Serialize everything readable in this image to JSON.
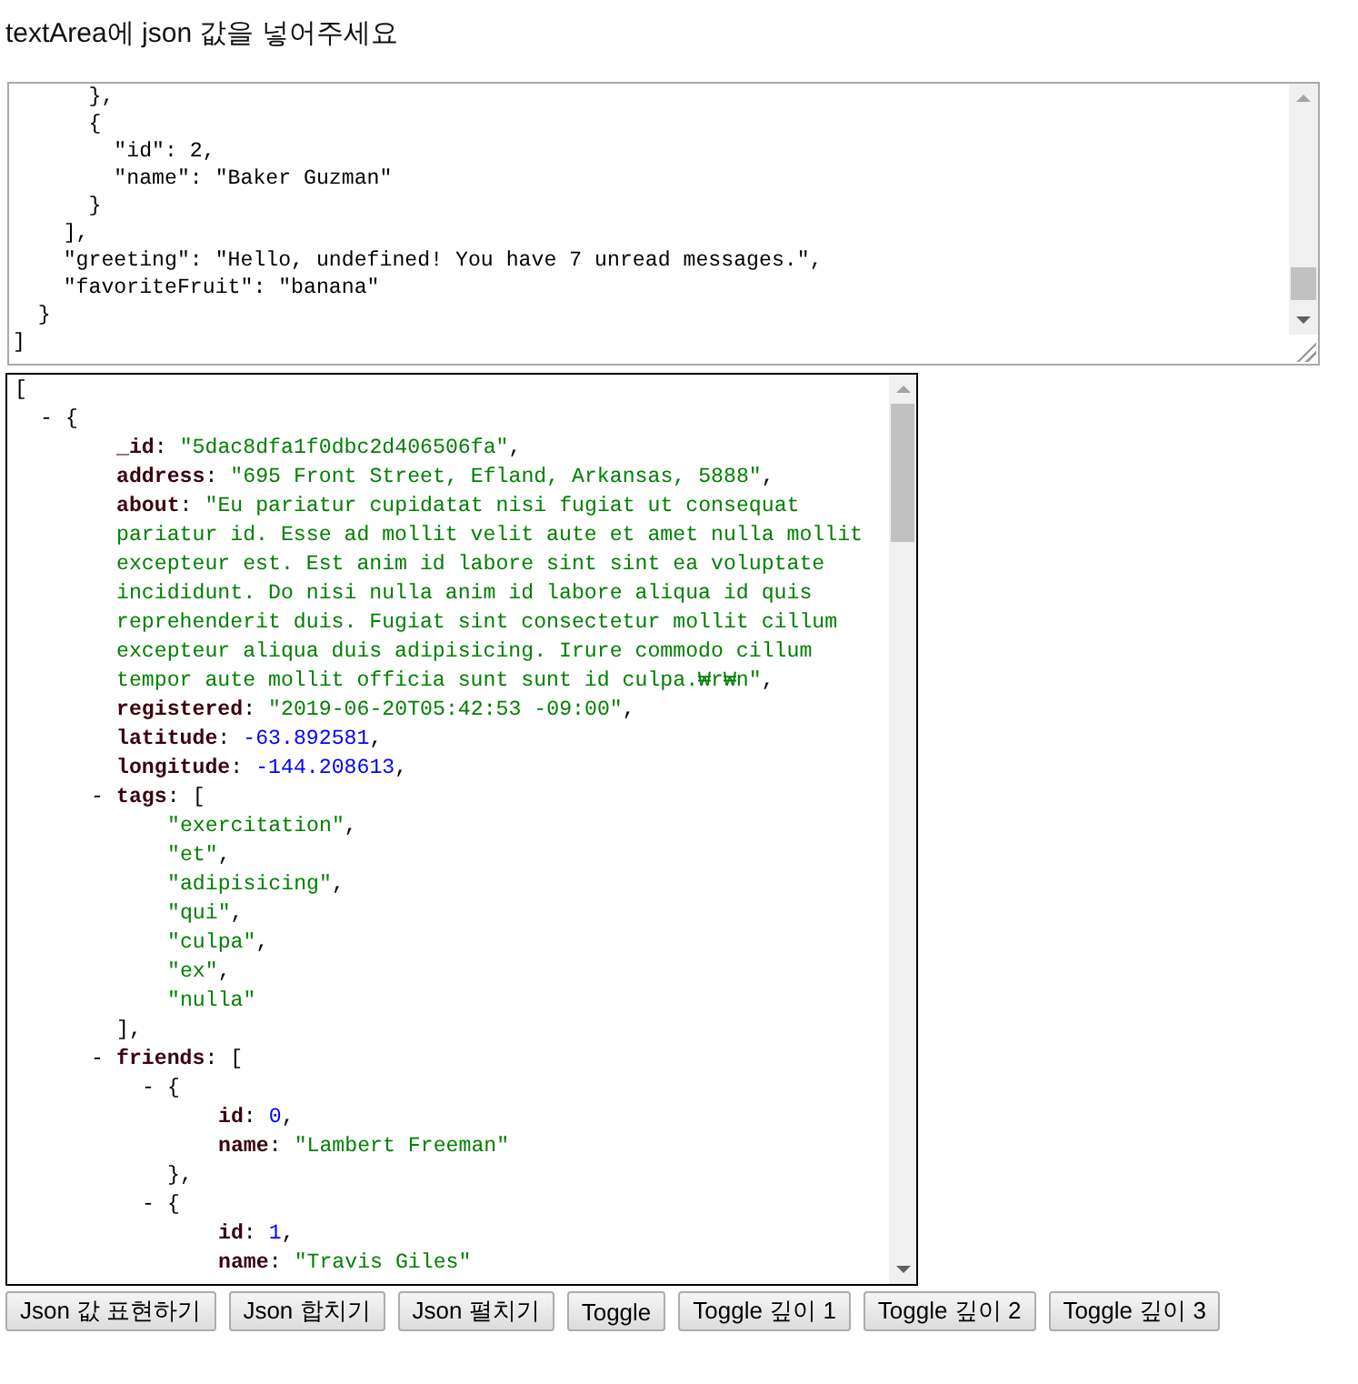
{
  "heading": "textArea에 json 값을 넣어주세요",
  "textarea": {
    "lines": [
      "      },",
      "      {",
      "        \"id\": 2,",
      "        \"name\": \"Baker Guzman\"",
      "      }",
      "    ],",
      "    \"greeting\": \"Hello, undefined! You have 7 unread messages.\",",
      "    \"favoriteFruit\": \"banana\"",
      "  }",
      "]"
    ]
  },
  "tree": {
    "open": "[",
    "children": [
      {
        "toggle": "-",
        "open": "{",
        "children": [
          {
            "key": "_id",
            "colon": ":",
            "value": "\"5dac8dfa1f0dbc2d406506fa\"",
            "kind": "string",
            "comma": ","
          },
          {
            "key": "address",
            "colon": ":",
            "value": "\"695 Front Street, Efland, Arkansas, 5888\"",
            "kind": "string",
            "comma": ","
          },
          {
            "key": "about",
            "colon": ":",
            "value": "\"Eu pariatur cupidatat nisi fugiat ut consequat pariatur id. Esse ad mollit velit aute et amet nulla mollit excepteur est. Est anim id labore sint sint ea voluptate incididunt. Do nisi nulla anim id labore aliqua id quis reprehenderit duis. Fugiat sint consectetur mollit cillum excepteur aliqua duis adipisicing. Irure commodo cillum tempor aute mollit officia sunt sunt id culpa.₩r₩n\"",
            "kind": "string",
            "comma": ","
          },
          {
            "key": "registered",
            "colon": ":",
            "value": "\"2019-06-20T05:42:53 -09:00\"",
            "kind": "string",
            "comma": ","
          },
          {
            "key": "latitude",
            "colon": ":",
            "value": "-63.892581",
            "kind": "number",
            "comma": ","
          },
          {
            "key": "longitude",
            "colon": ":",
            "value": "-144.208613",
            "kind": "number",
            "comma": ","
          },
          {
            "key": "tags",
            "colon": ":",
            "toggle": "-",
            "open": "[",
            "close": "]",
            "comma": ",",
            "children": [
              {
                "value": "\"exercitation\"",
                "kind": "string",
                "comma": ","
              },
              {
                "value": "\"et\"",
                "kind": "string",
                "comma": ","
              },
              {
                "value": "\"adipisicing\"",
                "kind": "string",
                "comma": ","
              },
              {
                "value": "\"qui\"",
                "kind": "string",
                "comma": ","
              },
              {
                "value": "\"culpa\"",
                "kind": "string",
                "comma": ","
              },
              {
                "value": "\"ex\"",
                "kind": "string",
                "comma": ","
              },
              {
                "value": "\"nulla\"",
                "kind": "string"
              }
            ]
          },
          {
            "key": "friends",
            "colon": ":",
            "toggle": "-",
            "open": "[",
            "children": [
              {
                "toggle": "-",
                "open": "{",
                "close": "}",
                "comma": ",",
                "children": [
                  {
                    "key": "id",
                    "colon": ":",
                    "value": "0",
                    "kind": "number",
                    "comma": ","
                  },
                  {
                    "key": "name",
                    "colon": ":",
                    "value": "\"Lambert Freeman\"",
                    "kind": "string"
                  }
                ]
              },
              {
                "toggle": "-",
                "open": "{",
                "children": [
                  {
                    "key": "id",
                    "colon": ":",
                    "value": "1",
                    "kind": "number",
                    "comma": ","
                  },
                  {
                    "key": "name",
                    "colon": ":",
                    "value": "\"Travis Giles\"",
                    "kind": "string"
                  }
                ]
              }
            ]
          }
        ]
      }
    ]
  },
  "buttons": [
    "Json 값 표현하기",
    "Json 합치기",
    "Json 펼치기",
    "Toggle",
    "Toggle 깊이 1",
    "Toggle 깊이 2",
    "Toggle 깊이 3"
  ]
}
